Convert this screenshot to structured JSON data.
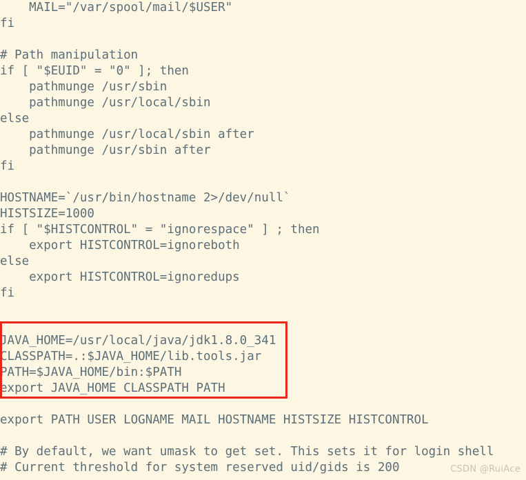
{
  "editor": {
    "background_color": "#fdf6e3",
    "text_color": "#5c6f78",
    "highlight_border_color": "#e8261c",
    "lines": [
      "    MAIL=\"/var/spool/mail/$USER\"",
      "fi",
      "",
      "# Path manipulation",
      "if [ \"$EUID\" = \"0\" ]; then",
      "    pathmunge /usr/sbin",
      "    pathmunge /usr/local/sbin",
      "else",
      "    pathmunge /usr/local/sbin after",
      "    pathmunge /usr/sbin after",
      "fi",
      "",
      "HOSTNAME=`/usr/bin/hostname 2>/dev/null`",
      "HISTSIZE=1000",
      "if [ \"$HISTCONTROL\" = \"ignorespace\" ] ; then",
      "    export HISTCONTROL=ignoreboth",
      "else",
      "    export HISTCONTROL=ignoredups",
      "fi",
      "",
      "",
      "JAVA_HOME=/usr/local/java/jdk1.8.0_341",
      "CLASSPATH=.:$JAVA_HOME/lib.tools.jar",
      "PATH=$JAVA_HOME/bin:$PATH",
      "export JAVA_HOME CLASSPATH PATH",
      "",
      "export PATH USER LOGNAME MAIL HOSTNAME HISTSIZE HISTCONTROL",
      "",
      "# By default, we want umask to get set. This sets it for login shell",
      "# Current threshold for system reserved uid/gids is 200"
    ]
  },
  "annotation": {
    "highlight_label": "java-env-vars-highlight"
  },
  "watermark": {
    "text": "CSDN @RuiAce"
  }
}
